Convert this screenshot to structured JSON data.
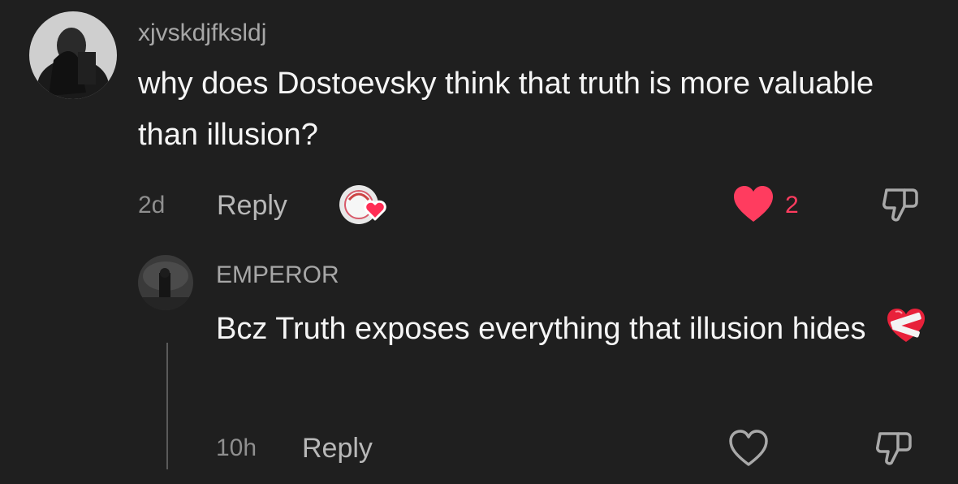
{
  "comments": [
    {
      "username": "xjvskdjfksldj",
      "text": "why does Dostoevsky think that truth is more valuable than illusion?",
      "age": "2d",
      "reply_label": "Reply",
      "likes": "2",
      "liked": true
    },
    {
      "username": "EMPEROR",
      "text": "Bcz Truth exposes everything that illusion hides",
      "emoji": "❤️‍🩹",
      "age": "10h",
      "reply_label": "Reply",
      "likes": "",
      "liked": false
    }
  ],
  "colors": {
    "background": "#1f1f1f",
    "like_active": "#ff3c5f"
  },
  "icons": [
    "heart-filled-icon",
    "heart-outline-icon",
    "thumbs-down-icon",
    "creator-liked-badge-icon",
    "mending-heart-emoji"
  ]
}
